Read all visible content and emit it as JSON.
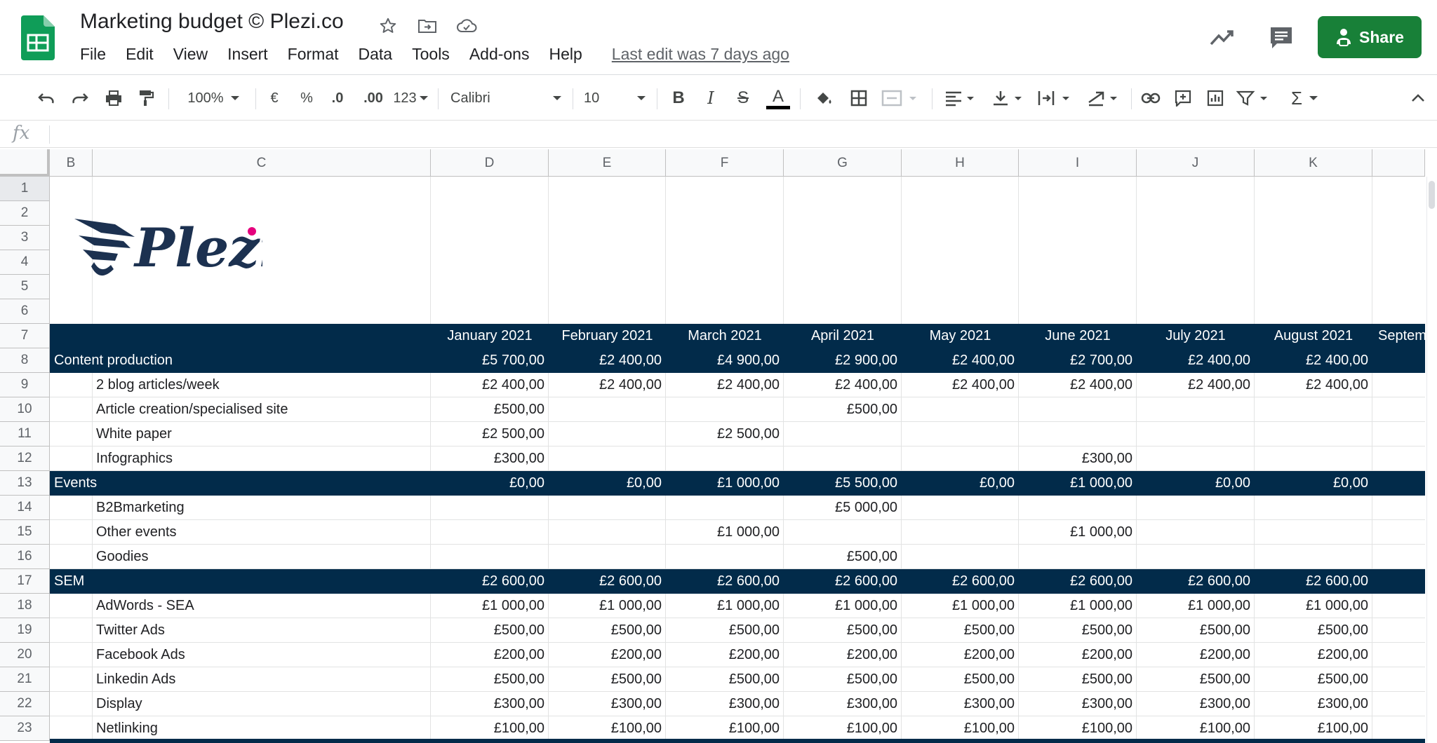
{
  "doc": {
    "title": "Marketing budget © Plezi.co",
    "last_edit": "Last edit was 7 days ago"
  },
  "menu": [
    "File",
    "Edit",
    "View",
    "Insert",
    "Format",
    "Data",
    "Tools",
    "Add-ons",
    "Help"
  ],
  "share_label": "Share",
  "toolbar": {
    "zoom": "100%",
    "currency": "€",
    "percent": "%",
    "dec_less": ".0",
    "dec_more": ".00",
    "more_formats": "123",
    "font": "Calibri",
    "font_size": "10",
    "bold": "B",
    "italic": "I",
    "strike": "S",
    "text_color": "A",
    "sum": "Σ"
  },
  "formula_bar": {
    "fx": "fx",
    "value": ""
  },
  "columns": [
    "B",
    "C",
    "D",
    "E",
    "F",
    "G",
    "H",
    "I",
    "J",
    "K",
    ""
  ],
  "row_numbers": [
    "1",
    "2",
    "3",
    "4",
    "5",
    "6",
    "7",
    "8",
    "9",
    "10",
    "11",
    "12",
    "13",
    "14",
    "15",
    "16",
    "17",
    "18",
    "19",
    "20",
    "21",
    "22",
    "23"
  ],
  "months": [
    "January 2021",
    "February 2021",
    "March 2021",
    "April 2021",
    "May 2021",
    "June 2021",
    "July 2021",
    "August 2021",
    "Septem"
  ],
  "rows": [
    {
      "type": "section",
      "label": "Content production",
      "values": [
        "£5 700,00",
        "£2 400,00",
        "£4 900,00",
        "£2 900,00",
        "£2 400,00",
        "£2 700,00",
        "£2 400,00",
        "£2 400,00"
      ]
    },
    {
      "type": "item",
      "label": "2 blog articles/week",
      "values": [
        "£2 400,00",
        "£2 400,00",
        "£2 400,00",
        "£2 400,00",
        "£2 400,00",
        "£2 400,00",
        "£2 400,00",
        "£2 400,00"
      ]
    },
    {
      "type": "item",
      "label": "Article creation/specialised site",
      "values": [
        "£500,00",
        "",
        "",
        "£500,00",
        "",
        "",
        "",
        ""
      ]
    },
    {
      "type": "item",
      "label": "White paper",
      "values": [
        "£2 500,00",
        "",
        "£2 500,00",
        "",
        "",
        "",
        "",
        ""
      ]
    },
    {
      "type": "item",
      "label": "Infographics",
      "values": [
        "£300,00",
        "",
        "",
        "",
        "",
        "£300,00",
        "",
        ""
      ]
    },
    {
      "type": "section",
      "label": "Events",
      "values": [
        "£0,00",
        "£0,00",
        "£1 000,00",
        "£5 500,00",
        "£0,00",
        "£1 000,00",
        "£0,00",
        "£0,00"
      ]
    },
    {
      "type": "item",
      "label": "B2Bmarketing",
      "values": [
        "",
        "",
        "",
        "£5 000,00",
        "",
        "",
        "",
        ""
      ]
    },
    {
      "type": "item",
      "label": "Other events",
      "values": [
        "",
        "",
        "£1 000,00",
        "",
        "",
        "£1 000,00",
        "",
        ""
      ]
    },
    {
      "type": "item",
      "label": "Goodies",
      "values": [
        "",
        "",
        "",
        "£500,00",
        "",
        "",
        "",
        ""
      ]
    },
    {
      "type": "section",
      "label": "SEM",
      "values": [
        "£2 600,00",
        "£2 600,00",
        "£2 600,00",
        "£2 600,00",
        "£2 600,00",
        "£2 600,00",
        "£2 600,00",
        "£2 600,00"
      ]
    },
    {
      "type": "item",
      "label": "AdWords - SEA",
      "values": [
        "£1 000,00",
        "£1 000,00",
        "£1 000,00",
        "£1 000,00",
        "£1 000,00",
        "£1 000,00",
        "£1 000,00",
        "£1 000,00"
      ]
    },
    {
      "type": "item",
      "label": "Twitter Ads",
      "values": [
        "£500,00",
        "£500,00",
        "£500,00",
        "£500,00",
        "£500,00",
        "£500,00",
        "£500,00",
        "£500,00"
      ]
    },
    {
      "type": "item",
      "label": "Facebook Ads",
      "values": [
        "£200,00",
        "£200,00",
        "£200,00",
        "£200,00",
        "£200,00",
        "£200,00",
        "£200,00",
        "£200,00"
      ]
    },
    {
      "type": "item",
      "label": "Linkedin Ads",
      "values": [
        "£500,00",
        "£500,00",
        "£500,00",
        "£500,00",
        "£500,00",
        "£500,00",
        "£500,00",
        "£500,00"
      ]
    },
    {
      "type": "item",
      "label": "Display",
      "values": [
        "£300,00",
        "£300,00",
        "£300,00",
        "£300,00",
        "£300,00",
        "£300,00",
        "£300,00",
        "£300,00"
      ]
    },
    {
      "type": "item",
      "label": "Netlinking",
      "values": [
        "£100,00",
        "£100,00",
        "£100,00",
        "£100,00",
        "£100,00",
        "£100,00",
        "£100,00",
        "£100,00"
      ]
    }
  ],
  "logo_text": "Plezi",
  "colors": {
    "header_fill": "#022b4a",
    "share_green": "#188038",
    "sheets_green": "#0f9d58",
    "logo_navy": "#1c3150",
    "logo_dot": "#e5007d"
  }
}
